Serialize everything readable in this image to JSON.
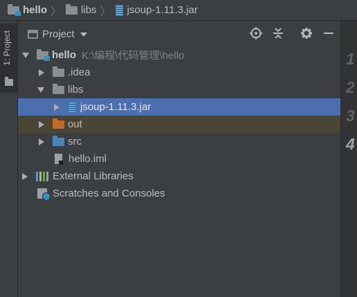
{
  "breadcrumb": [
    {
      "label": "hello",
      "icon": "module-folder-icon",
      "bold": true
    },
    {
      "label": "libs",
      "icon": "folder-icon",
      "bold": false
    },
    {
      "label": "jsoup-1.11.3.jar",
      "icon": "jar-icon",
      "bold": false
    }
  ],
  "side_tab": {
    "label": "1: Project",
    "icon": "project-tool-icon"
  },
  "panel": {
    "title": "Project",
    "buttons": [
      "locate-icon",
      "collapse-all-icon",
      "settings-gear-icon",
      "hide-panel-icon"
    ]
  },
  "tree": {
    "root": {
      "label": "hello",
      "path": "K:\\编程\\代码管理\\hello",
      "expanded": true
    },
    "idea": {
      "label": ".idea"
    },
    "libs": {
      "label": "libs",
      "expanded": true
    },
    "jar": {
      "label": "jsoup-1.11.3.jar",
      "selected": true
    },
    "out": {
      "label": "out",
      "excluded": true
    },
    "src": {
      "label": "src"
    },
    "iml": {
      "label": "hello.iml"
    },
    "ext": {
      "label": "External Libraries"
    },
    "scratch": {
      "label": "Scratches and Consoles"
    }
  },
  "editor": {
    "line_numbers": [
      "1",
      "2",
      "3",
      "4"
    ],
    "current_line": "4"
  },
  "colors": {
    "selection": "#4b6eaf",
    "excluded_row": "#4b4535",
    "panel_bg": "#3c3f41",
    "editor_bg": "#2b2b2b"
  }
}
